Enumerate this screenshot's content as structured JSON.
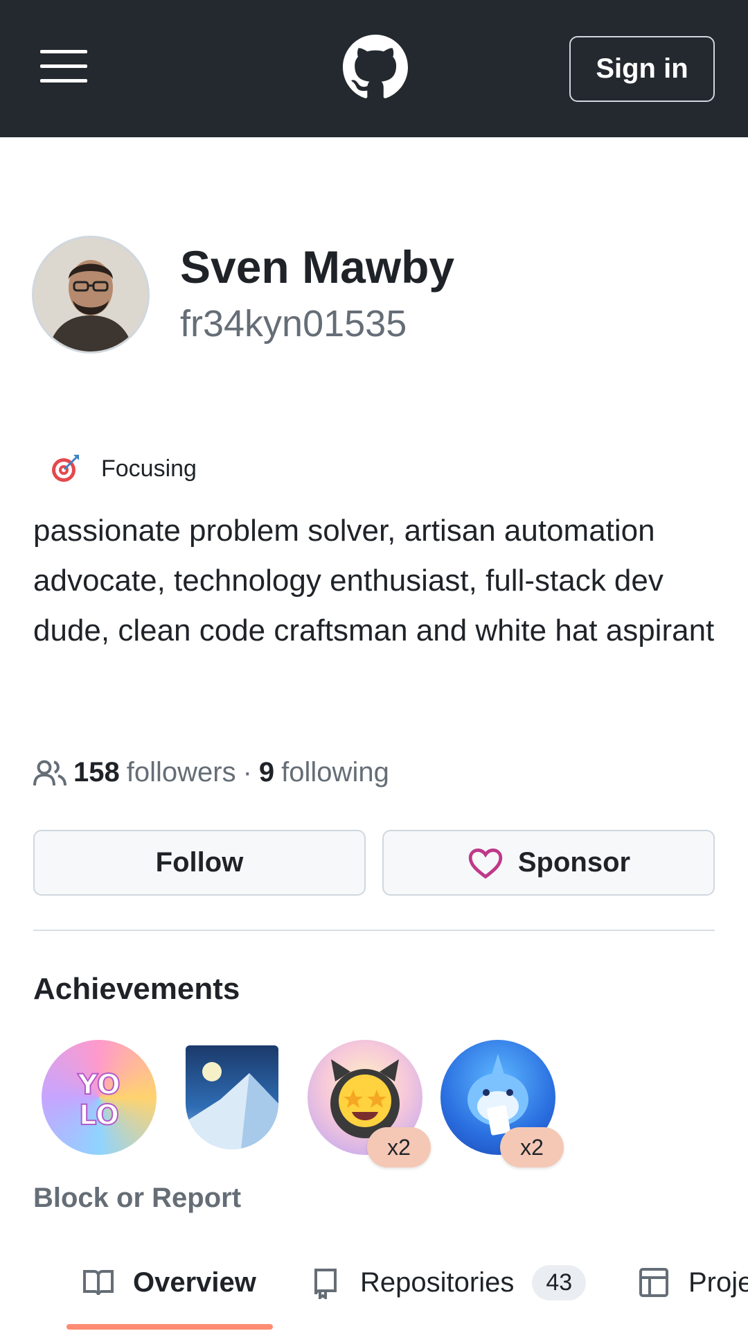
{
  "header": {
    "menu_icon": "hamburger-menu-icon",
    "logo_icon": "github-logo",
    "sign_in_label": "Sign in"
  },
  "profile": {
    "full_name": "Sven Mawby",
    "username": "fr34kyn01535",
    "status": {
      "icon": "direct-hit-icon",
      "text": "Focusing"
    },
    "bio": "passionate problem solver, artisan automation advocate, technology enthusiast, full-stack dev dude, clean code craftsman and white hat aspirant",
    "followers_count": "158",
    "followers_label": "followers",
    "separator": "·",
    "following_count": "9",
    "following_label": "following"
  },
  "actions": {
    "follow_label": "Follow",
    "sponsor_label": "Sponsor",
    "sponsor_color": "#bf3989"
  },
  "achievements": {
    "title": "Achievements",
    "badges": [
      {
        "name": "yolo-badge",
        "count": ""
      },
      {
        "name": "arctic-code-vault-badge",
        "count": ""
      },
      {
        "name": "starstruck-badge",
        "count": "x2"
      },
      {
        "name": "pull-shark-badge",
        "count": "x2"
      }
    ]
  },
  "block_report_label": "Block or Report",
  "tabs": [
    {
      "label": "Overview",
      "icon": "book-icon",
      "active": true
    },
    {
      "label": "Repositories",
      "icon": "repo-icon",
      "count": "43"
    },
    {
      "label": "Proje",
      "icon": "table-icon"
    }
  ],
  "colors": {
    "header_bg": "#24292f",
    "accent_underline": "#fd8c73",
    "muted_text": "#656d76"
  }
}
